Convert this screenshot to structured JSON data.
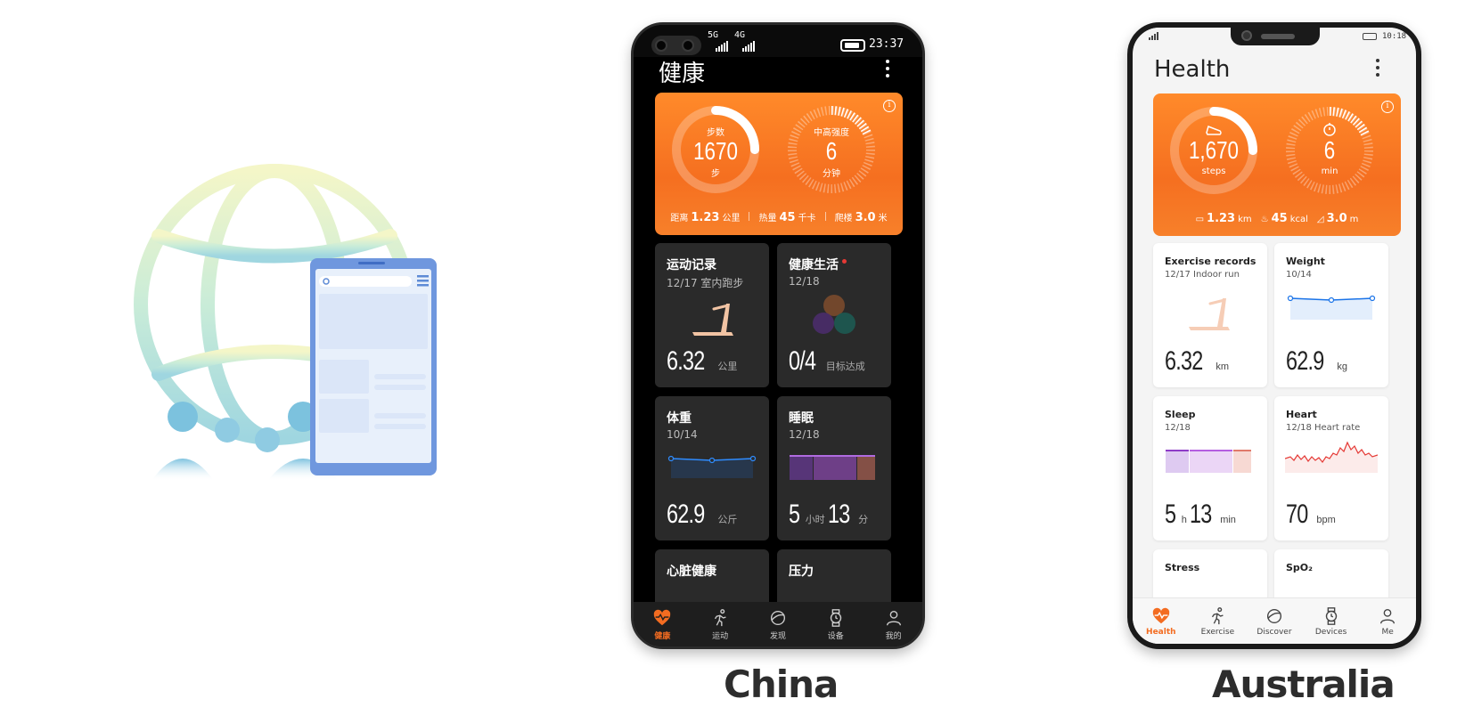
{
  "china": {
    "caption": "China",
    "status": {
      "net1": "5G",
      "net2": "4G",
      "time": "23:37"
    },
    "title": "健康",
    "summary": {
      "left_label": "步数",
      "left_value": "1670",
      "left_unit": "步",
      "left_progress": 0.25,
      "right_label": "中高强度",
      "right_value": "6",
      "right_unit": "分钟",
      "right_progress": 0.2,
      "distance_label": "距离",
      "distance_value": "1.23",
      "distance_unit": "公里",
      "calories_label": "热量",
      "calories_value": "45",
      "calories_unit": "千卡",
      "floors_label": "爬楼",
      "floors_value": "3.0",
      "floors_unit": "米"
    },
    "tiles": {
      "exercise": {
        "title": "运动记录",
        "sub": "12/17 室内跑步",
        "value": "6.32",
        "unit": "公里"
      },
      "healthy": {
        "title": "健康生活",
        "sub": "12/18",
        "value": "0/4",
        "unit": "目标达成"
      },
      "weight": {
        "title": "体重",
        "sub": "10/14",
        "value": "62.9",
        "unit": "公斤"
      },
      "sleep": {
        "title": "睡眠",
        "sub": "12/18",
        "value1": "5",
        "unit1": "小时",
        "value2": "13",
        "unit2": "分"
      },
      "heart": {
        "title": "心脏健康"
      },
      "stress": {
        "title": "压力"
      }
    },
    "nav": [
      "健康",
      "运动",
      "发现",
      "设备",
      "我的"
    ]
  },
  "australia": {
    "caption": "Australia",
    "status": {
      "time": "10:18"
    },
    "title": "Health",
    "summary": {
      "left_value": "1,670",
      "left_unit": "steps",
      "left_progress": 0.25,
      "right_value": "6",
      "right_unit": "min",
      "right_progress": 0.2,
      "distance_value": "1.23",
      "distance_unit": "km",
      "calories_value": "45",
      "calories_unit": "kcal",
      "floors_value": "3.0",
      "floors_unit": "m"
    },
    "tiles": {
      "exercise": {
        "title": "Exercise records",
        "sub": "12/17 Indoor run",
        "value": "6.32",
        "unit": "km"
      },
      "weight": {
        "title": "Weight",
        "sub": "10/14",
        "value": "62.9",
        "unit": "kg"
      },
      "sleep": {
        "title": "Sleep",
        "sub": "12/18",
        "value1": "5",
        "unit1": "h",
        "value2": "13",
        "unit2": "min"
      },
      "heart": {
        "title": "Heart",
        "sub": "12/18 Heart rate",
        "value": "70",
        "unit": "bpm"
      },
      "stress": {
        "title": "Stress"
      },
      "spo2": {
        "title": "SpO₂"
      }
    },
    "nav": [
      "Health",
      "Exercise",
      "Discover",
      "Devices",
      "Me"
    ]
  },
  "colors": {
    "accent": "#f36c21",
    "card_orange": "#f7802a",
    "line_blue": "#1a73e8",
    "sleep_purple": "#8e3cc7",
    "heart_red": "#e53935"
  }
}
